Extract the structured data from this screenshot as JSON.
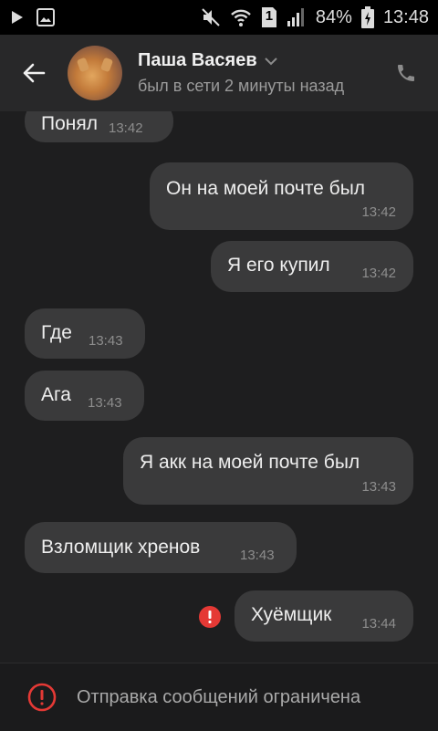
{
  "status_bar": {
    "battery": "84%",
    "time": "13:48",
    "sim": "1",
    "icons": [
      "play-icon",
      "image-icon",
      "mute-icon",
      "wifi-icon",
      "sim-icon",
      "signal-icon",
      "battery-icon"
    ]
  },
  "header": {
    "name": "Паша Васяев",
    "status": "был в сети 2 минуты назад",
    "icons": [
      "back-arrow-icon",
      "chevron-down-icon",
      "phone-icon"
    ]
  },
  "messages": [
    {
      "dir": "in",
      "text": "Понял",
      "time": "13:42"
    },
    {
      "dir": "out",
      "text": "Он на моей почте был",
      "time": "13:42"
    },
    {
      "dir": "out",
      "text": "Я его купил",
      "time": "13:42"
    },
    {
      "dir": "in",
      "text": "Где",
      "time": "13:43"
    },
    {
      "dir": "in",
      "text": "Ага",
      "time": "13:43"
    },
    {
      "dir": "out",
      "text": "Я акк на моей почте был",
      "time": "13:43"
    },
    {
      "dir": "in",
      "text": "Взломщик хренов",
      "time": "13:43"
    },
    {
      "dir": "out",
      "text": "Хуёмщик",
      "time": "13:44",
      "failed": true
    }
  ],
  "bottom": {
    "text": "Отправка сообщений ограничена",
    "icon": "alert-circle-icon"
  },
  "colors": {
    "background": "#1e1e1f",
    "header": "#282829",
    "bubble": "#3a3a3b",
    "error": "#e53935"
  }
}
